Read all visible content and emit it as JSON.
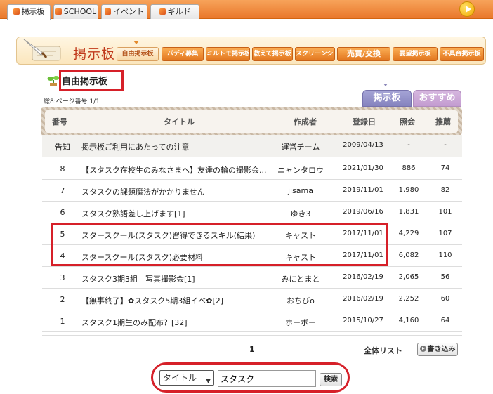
{
  "top_tabs": [
    {
      "label": "掲示板",
      "active": true
    },
    {
      "label": "SCHOOL"
    },
    {
      "label": "イベント"
    },
    {
      "label": "ギルド"
    }
  ],
  "banner": {
    "title": "掲示板"
  },
  "nav": [
    "自由掲示板",
    "バディ募集",
    "ミルトモ掲示板",
    "教えて掲示板",
    "スクリーンショット",
    "売買/交換",
    "要望掲示板",
    "不具合掲示板"
  ],
  "board": {
    "title": "自由掲示板",
    "page_info": "総8:ページ番号 1/1"
  },
  "side_tabs": {
    "board": "掲示板",
    "recommend": "おすすめ"
  },
  "table": {
    "headers": {
      "num": "番号",
      "title": "タイトル",
      "author": "作成者",
      "date": "登録日",
      "views": "照会",
      "recommend": "推薦"
    },
    "rows": [
      {
        "num": "告知",
        "title": "掲示板ご利用にあたっての注意",
        "author": "運営チーム",
        "date": "2009/04/13",
        "views": "-",
        "recommend": "-"
      },
      {
        "num": "8",
        "title": "【スタスク在校生のみなさまへ】友達の輪の撮影会...",
        "author": "ニャンタロウ",
        "date": "2021/01/30",
        "views": "886",
        "recommend": "74"
      },
      {
        "num": "7",
        "title": "スタスクの課題魔法がかかりません",
        "author": "jisama",
        "date": "2019/11/01",
        "views": "1,980",
        "recommend": "82"
      },
      {
        "num": "6",
        "title": "スタスク熟語差し上げます[1]",
        "author": "ゆき3",
        "date": "2019/06/16",
        "views": "1,831",
        "recommend": "101"
      },
      {
        "num": "5",
        "title": "スタースクール(スタスク)習得できるスキル(結果)",
        "author": "キャスト",
        "date": "2017/11/01",
        "views": "4,229",
        "recommend": "107"
      },
      {
        "num": "4",
        "title": "スタースクール(スタスク)必要材料",
        "author": "キャスト",
        "date": "2017/11/01",
        "views": "6,082",
        "recommend": "110"
      },
      {
        "num": "3",
        "title": "スタスク3期3組　写真撮影会[1]",
        "author": "みにとまと",
        "date": "2016/02/19",
        "views": "2,065",
        "recommend": "56"
      },
      {
        "num": "2",
        "title": "【無事終了】✿スタスク5期3組イベ✿[2]",
        "author": "おちびo",
        "date": "2016/02/19",
        "views": "2,252",
        "recommend": "60"
      },
      {
        "num": "1",
        "title": "スタスク1期生のみ配布？[32]",
        "author": "ホーボー",
        "date": "2015/10/27",
        "views": "4,160",
        "recommend": "64"
      }
    ]
  },
  "pager": {
    "current": "1",
    "all_list": "全体リスト",
    "write_label": "書き込み"
  },
  "search": {
    "field_select": "タイトル",
    "query": "スタスク",
    "button": "検索"
  },
  "colors": {
    "topbar": "#ee8a3b",
    "banner_title": "#c0391b",
    "highlight_red": "#d62029",
    "tab_board": "#9695c9",
    "tab_recommend": "#cfa9da"
  }
}
